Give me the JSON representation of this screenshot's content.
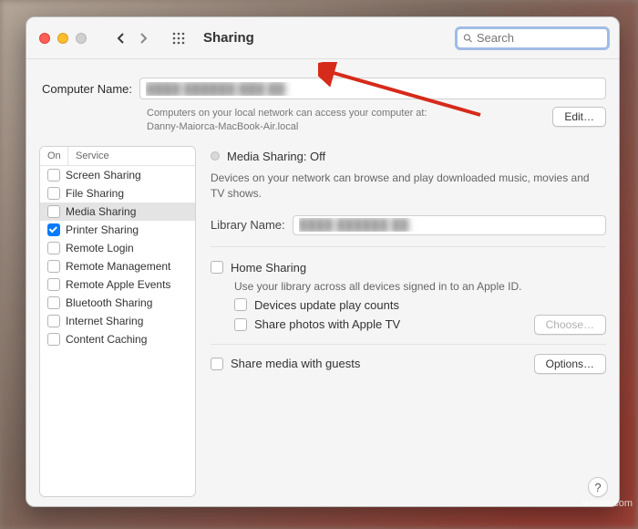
{
  "window": {
    "title": "Sharing"
  },
  "search": {
    "placeholder": "Search"
  },
  "computer": {
    "label": "Computer Name:",
    "value": "████ ██████ ███ ██",
    "hint1": "Computers on your local network can access your computer at:",
    "hint2": "Danny-Maiorca-MacBook-Air.local",
    "edit": "Edit…"
  },
  "sidebar": {
    "on_header": "On",
    "service_header": "Service",
    "items": [
      {
        "label": "Screen Sharing",
        "checked": false,
        "selected": false
      },
      {
        "label": "File Sharing",
        "checked": false,
        "selected": false
      },
      {
        "label": "Media Sharing",
        "checked": false,
        "selected": true
      },
      {
        "label": "Printer Sharing",
        "checked": true,
        "selected": false
      },
      {
        "label": "Remote Login",
        "checked": false,
        "selected": false
      },
      {
        "label": "Remote Management",
        "checked": false,
        "selected": false
      },
      {
        "label": "Remote Apple Events",
        "checked": false,
        "selected": false
      },
      {
        "label": "Bluetooth Sharing",
        "checked": false,
        "selected": false
      },
      {
        "label": "Internet Sharing",
        "checked": false,
        "selected": false
      },
      {
        "label": "Content Caching",
        "checked": false,
        "selected": false
      }
    ]
  },
  "main": {
    "status": "Media Sharing: Off",
    "description": "Devices on your network can browse and play downloaded music, movies and TV shows.",
    "library_label": "Library Name:",
    "library_value": "████ ██████ ██",
    "home_sharing": "Home Sharing",
    "home_hint": "Use your library across all devices signed in to an Apple ID.",
    "devices_update": "Devices update play counts",
    "share_photos": "Share photos with Apple TV",
    "choose": "Choose…",
    "share_guests": "Share media with guests",
    "options": "Options…"
  },
  "footer": {
    "watermark": "wsxdn.com"
  }
}
